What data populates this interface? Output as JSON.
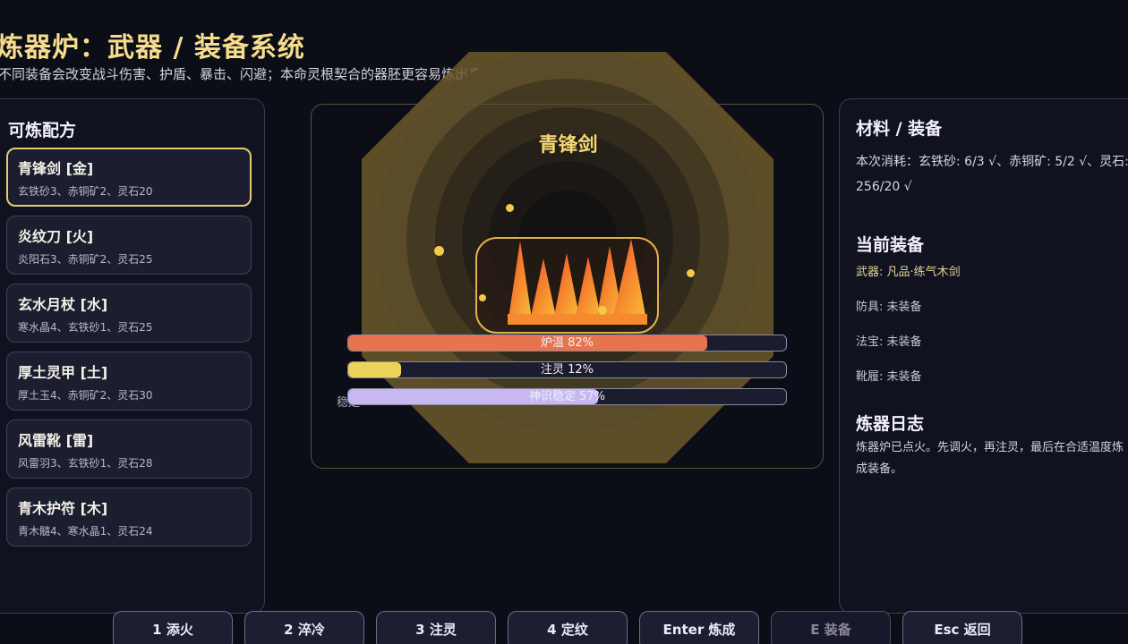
{
  "header": {
    "title": "炼器炉：武器 / 装备系统",
    "subtitle": "不同装备会改变战斗伤害、护盾、暴击、闪避；本命灵根契合的器胚更容易炼出高品质。"
  },
  "recipes": {
    "heading": "可炼配方",
    "items": [
      {
        "name": "青锋剑 [金]",
        "mats": "玄铁砂3、赤铜矿2、灵石20"
      },
      {
        "name": "炎纹刀 [火]",
        "mats": "炎阳石3、赤铜矿2、灵石25"
      },
      {
        "name": "玄水月杖 [水]",
        "mats": "寒水晶4、玄铁砂1、灵石25"
      },
      {
        "name": "厚土灵甲 [土]",
        "mats": "厚土玉4、赤铜矿2、灵石30"
      },
      {
        "name": "风雷靴 [雷]",
        "mats": "风雷羽3、玄铁砂1、灵石28"
      },
      {
        "name": "青木护符 [木]",
        "mats": "青木髓4、寒水晶1、灵石24"
      }
    ]
  },
  "furnace": {
    "weapon_name": "青锋剑",
    "bars": [
      {
        "label": "炉温 82%",
        "value": 0.82,
        "color": "#e8734f"
      },
      {
        "label": "注灵 12%",
        "value": 0.12,
        "color": "#ecd35a"
      },
      {
        "label": "神识稳定 57%",
        "value": 0.57,
        "color": "#c8b8f2"
      }
    ],
    "under_text": "稳定"
  },
  "materials": {
    "heading": "材料 / 装备",
    "cost": "本次消耗：玄铁砂: 6/3 √、赤铜矿: 5/2 √、灵石: 256/20 √"
  },
  "equipment": {
    "heading": "当前装备",
    "weapon": "武器: 凡品·练气木剑",
    "armor": "防具: 未装备",
    "treasure": "法宝: 未装备",
    "boots": "靴履: 未装备"
  },
  "log": {
    "heading": "炼器日志",
    "text": "炼器炉已点火。先调火，再注灵，最后在合适温度炼成装备。"
  },
  "buttons": [
    {
      "label": "1 添火",
      "disabled": false
    },
    {
      "label": "2 淬冷",
      "disabled": false
    },
    {
      "label": "3 注灵",
      "disabled": false
    },
    {
      "label": "4 定纹",
      "disabled": false
    },
    {
      "label": "Enter 炼成",
      "disabled": false
    },
    {
      "label": "E 装备",
      "disabled": true
    },
    {
      "label": "Esc 返回",
      "disabled": false
    }
  ],
  "colors": {
    "accent_gold": "#f5d773",
    "selected_border": "#e8c877",
    "background": "#0b0d17"
  }
}
